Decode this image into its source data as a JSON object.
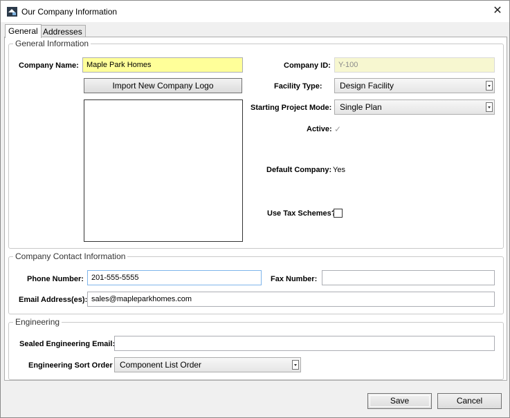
{
  "window": {
    "title": "Our Company Information",
    "close_glyph": "✕"
  },
  "tabs": [
    {
      "label": "General"
    },
    {
      "label": "Addresses"
    }
  ],
  "general_info": {
    "legend": "General Information",
    "company_name_label": "Company Name:",
    "company_name_value": "Maple Park Homes",
    "import_logo_label": "Import New Company Logo",
    "company_id_label": "Company ID:",
    "company_id_value": "Y-100",
    "facility_type_label": "Facility Type:",
    "facility_type_value": "Design Facility",
    "starting_mode_label": "Starting Project Mode:",
    "starting_mode_value": "Single Plan",
    "active_label": "Active:",
    "active_checked": true,
    "active_glyph": "✓",
    "default_company_label": "Default Company:",
    "default_company_value": "Yes",
    "use_tax_label": "Use Tax Schemes?",
    "use_tax_checked": false
  },
  "contact_info": {
    "legend": "Company Contact Information",
    "phone_label": "Phone Number:",
    "phone_value": "201-555-5555",
    "fax_label": "Fax Number:",
    "fax_value": "",
    "email_label": "Email Address(es):",
    "email_value": "sales@mapleparkhomes.com"
  },
  "engineering": {
    "legend": "Engineering",
    "sealed_email_label": "Sealed Engineering Email:",
    "sealed_email_value": "",
    "sort_order_label": "Engineering Sort Order",
    "sort_order_value": "Component List Order"
  },
  "footer": {
    "save_label": "Save",
    "cancel_label": "Cancel"
  }
}
